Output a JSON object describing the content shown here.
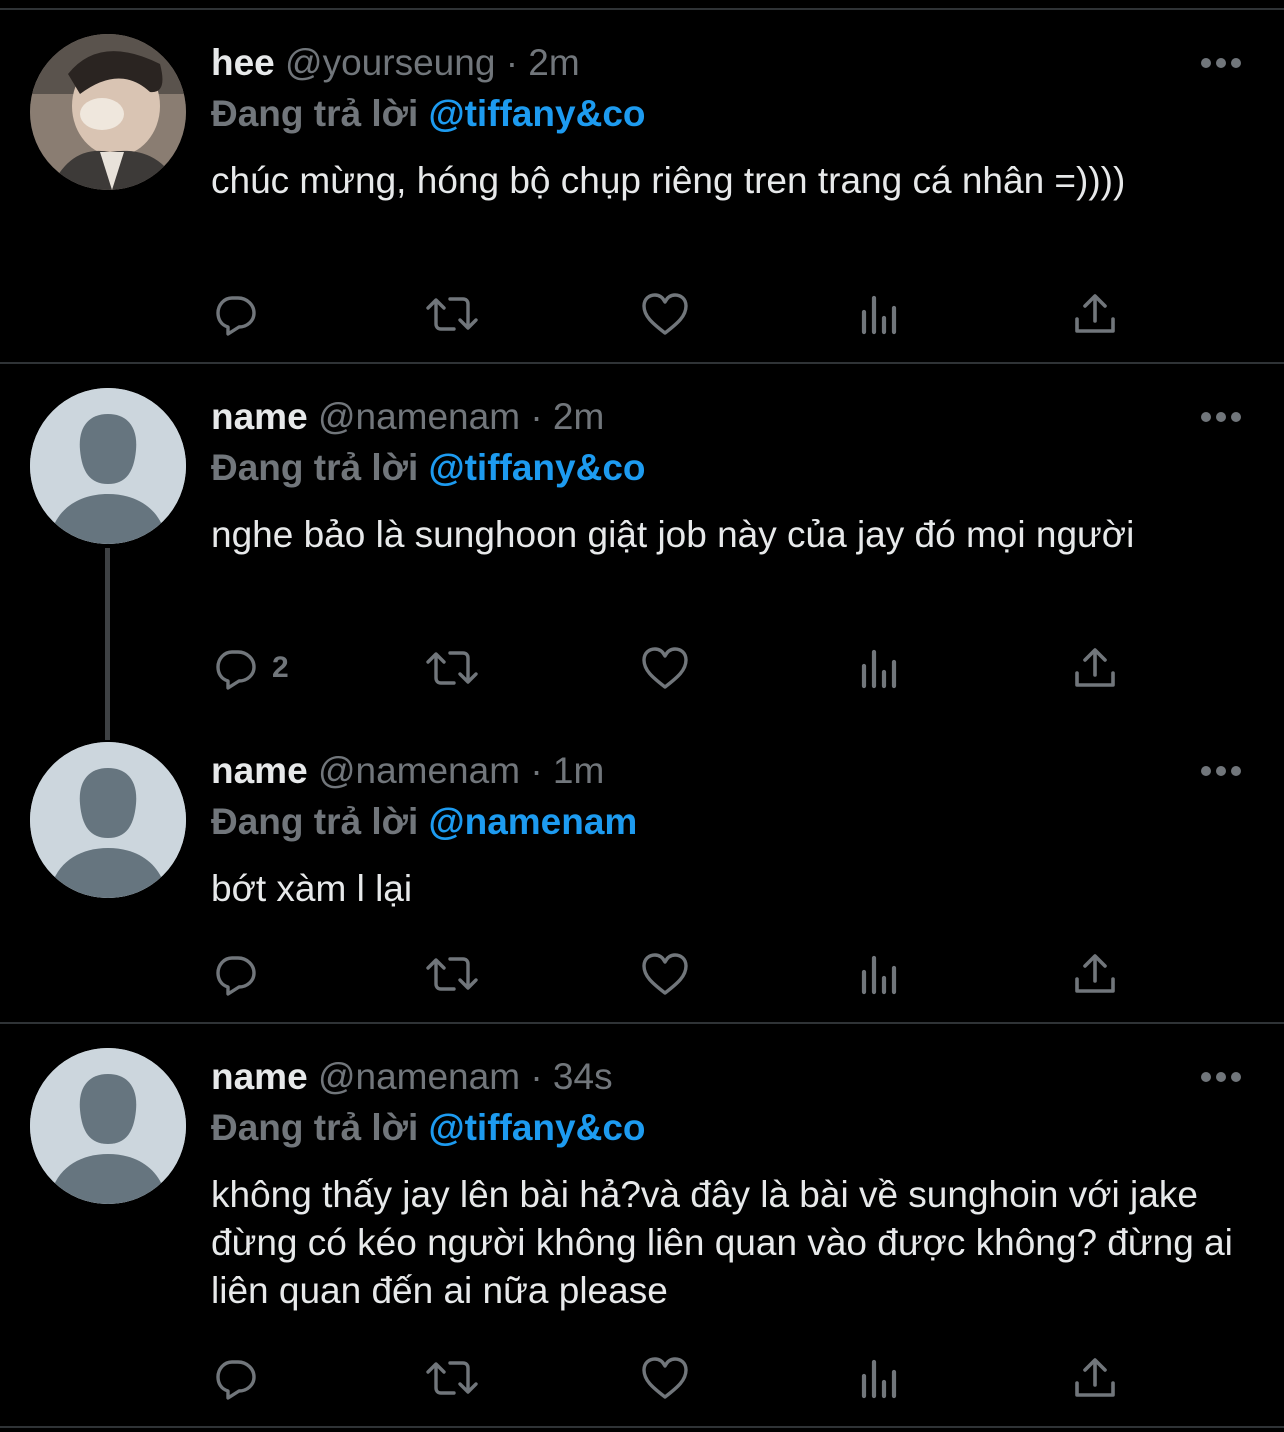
{
  "theme": {
    "background": "#000000",
    "muted": "#71767b",
    "accent": "#1d9bf0",
    "divider": "#2f3336"
  },
  "tweets": [
    {
      "display_name": "hee",
      "handle": "@yourseung",
      "separator": "·",
      "time": "2m",
      "reply_prefix": "Đang trả lời",
      "reply_to": "@tiffany&co",
      "text": "chúc mừng, hóng bộ chụp riêng tren trang cá nhân =))))",
      "avatar": "photo-avatar",
      "reply_count": ""
    },
    {
      "display_name": "name",
      "handle": "@namenam",
      "separator": "·",
      "time": "2m",
      "reply_prefix": "Đang trả lời",
      "reply_to": "@tiffany&co",
      "text": "nghe bảo là sunghoon giật job này của jay đó mọi người",
      "avatar": "default-avatar",
      "reply_count": "2"
    },
    {
      "display_name": "name",
      "handle": "@namenam",
      "separator": "·",
      "time": "1m",
      "reply_prefix": "Đang trả lời",
      "reply_to": "@namenam",
      "text": "bớt xàm l lại",
      "avatar": "default-avatar",
      "reply_count": ""
    },
    {
      "display_name": "name",
      "handle": "@namenam",
      "separator": "·",
      "time": "34s",
      "reply_prefix": "Đang trả lời",
      "reply_to": "@tiffany&co",
      "text": "không thấy jay lên bài hả?và đây là bài về sunghoin với jake đừng có kéo người không liên quan vào được không? đừng ai liên quan đến ai nữa please",
      "avatar": "default-avatar",
      "reply_count": ""
    }
  ],
  "action_icons": [
    "reply-icon",
    "retweet-icon",
    "like-icon",
    "views-icon",
    "share-icon"
  ],
  "more_icon": "more-icon"
}
